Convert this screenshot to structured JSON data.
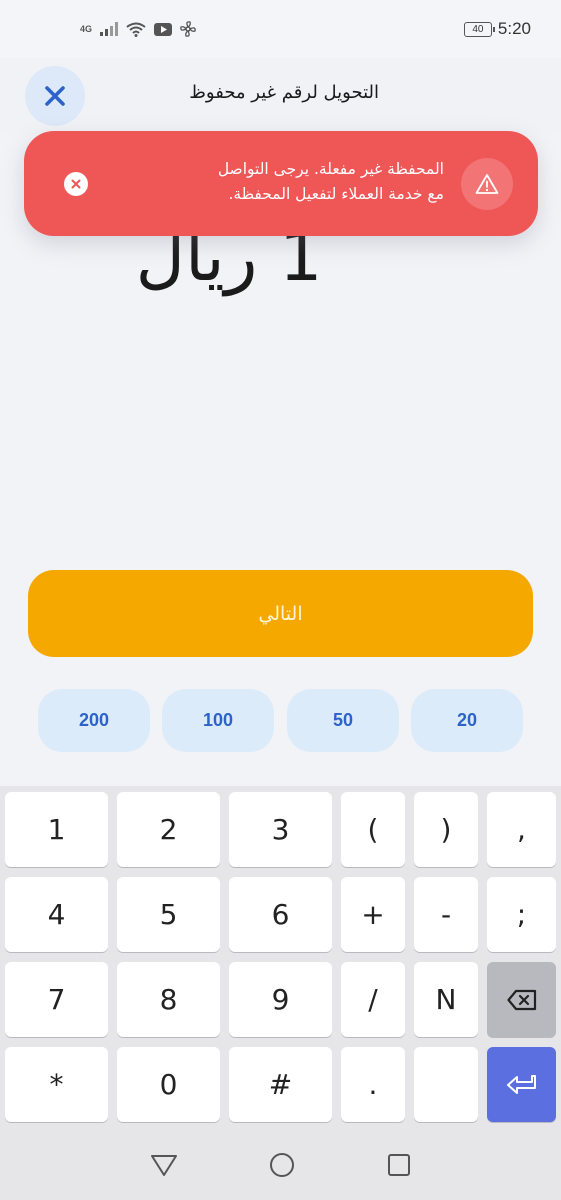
{
  "status_bar": {
    "network": "4G",
    "battery": "40",
    "time": "5:20"
  },
  "header": {
    "title": "التحويل لرقم غير محفوظ",
    "close_icon": "close-icon"
  },
  "alert": {
    "message_line1": "المحفظة غير مفعلة. يرجى التواصل",
    "message_line2": "مع خدمة العملاء لتفعيل المحفظة.",
    "color": "#ef5656",
    "icon": "warning-icon"
  },
  "amount": {
    "value": "1",
    "currency": "ريال"
  },
  "next_button": {
    "label": "التالي",
    "color": "#f5a800"
  },
  "quick_amounts": [
    "20",
    "50",
    "100",
    "200"
  ],
  "keyboard": {
    "rows": [
      [
        "1",
        "2",
        "3",
        "(",
        ")",
        ","
      ],
      [
        "4",
        "5",
        "6",
        "+",
        "-",
        ";"
      ],
      [
        "7",
        "8",
        "9",
        "/",
        "N",
        "backspace"
      ],
      [
        "*",
        "0",
        "#",
        ".",
        "",
        "enter"
      ]
    ]
  },
  "navbar": {
    "icons": [
      "back-icon",
      "home-icon",
      "recents-icon"
    ]
  }
}
